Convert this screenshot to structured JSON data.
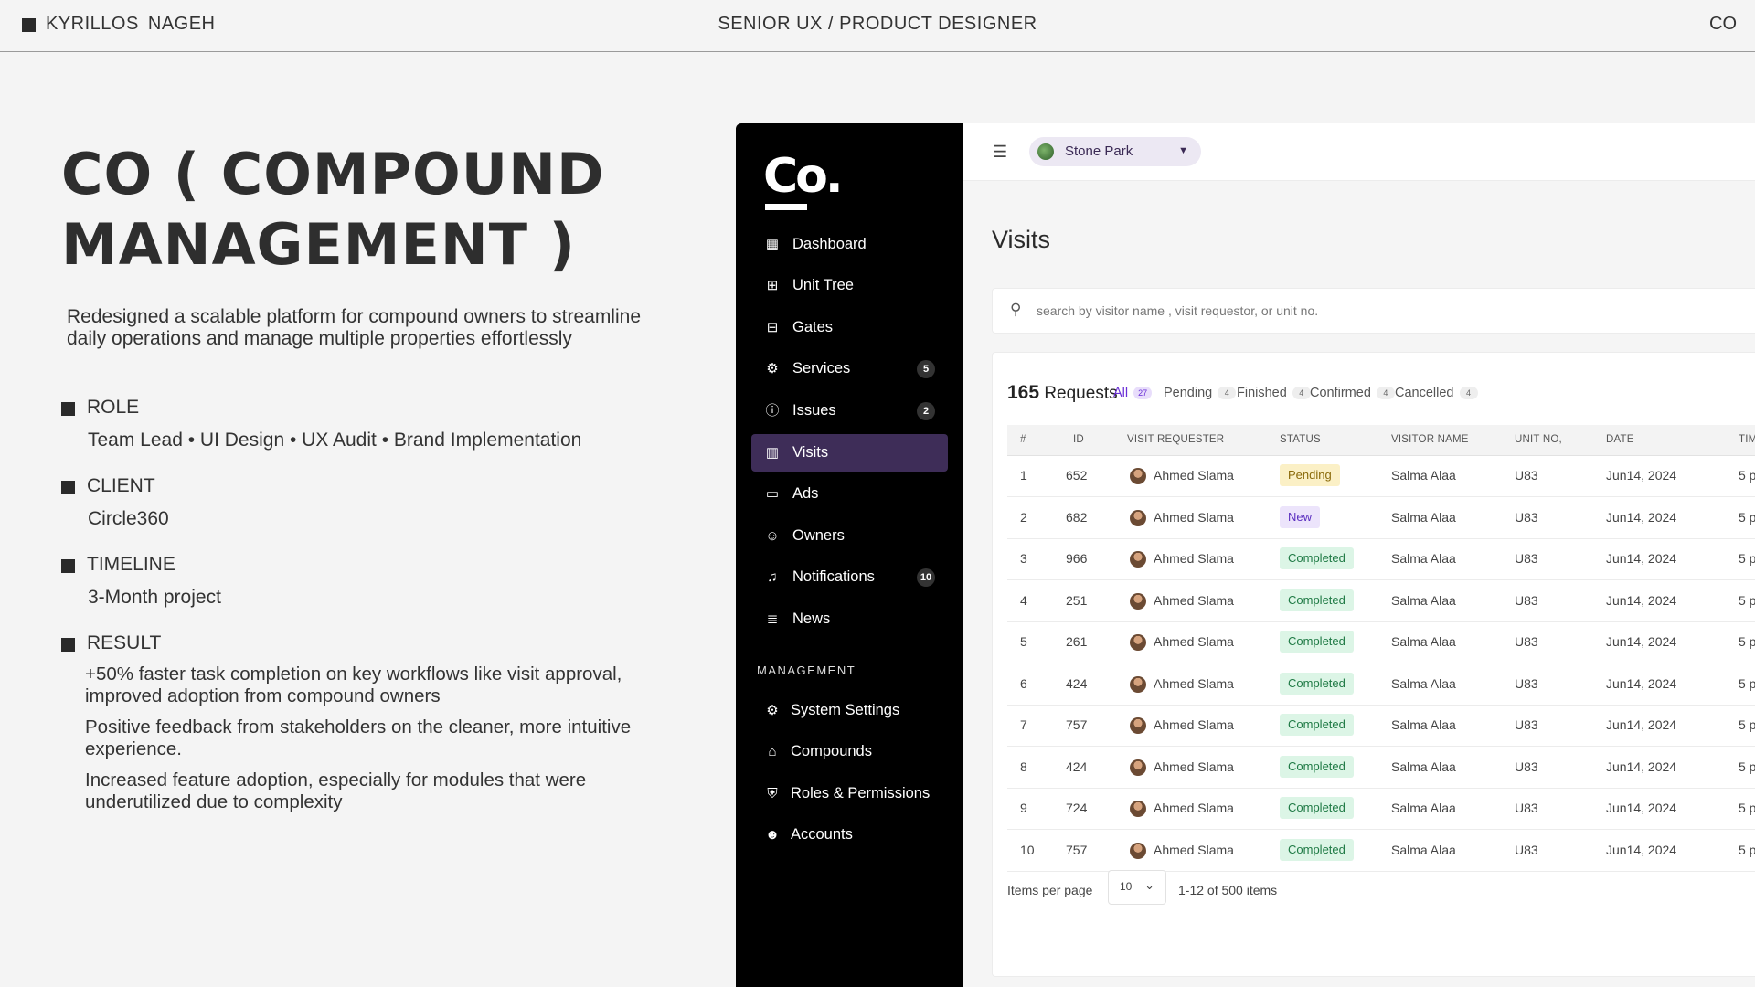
{
  "topbar": {
    "name": "KYRILLOS  NAGEH",
    "role": "SENIOR UX / PRODUCT DESIGNER",
    "short": "CO"
  },
  "case": {
    "title": "CO ( COMPOUND MANAGEMENT )",
    "description": "Redesigned a scalable platform for compound owners to streamline daily operations and manage multiple properties effortlessly",
    "sections": [
      {
        "label": "ROLE",
        "value": "Team Lead • UI Design • UX Audit • Brand Implementation"
      },
      {
        "label": "CLIENT",
        "value": "Circle360"
      },
      {
        "label": "TIMELINE",
        "value": "3-Month project"
      },
      {
        "label": "RESULT",
        "value": ""
      }
    ],
    "results": [
      "+50% faster task completion on key workflows like visit approval, improved adoption from compound owners",
      "Positive feedback from stakeholders on the cleaner, more intuitive experience.",
      "Increased feature adoption, especially for modules that were underutilized due to complexity"
    ]
  },
  "app": {
    "logo": "Co.",
    "nav": [
      {
        "label": "Dashboard",
        "icon": "dashboard-icon",
        "badge": ""
      },
      {
        "label": "Unit Tree",
        "icon": "tree-icon",
        "badge": ""
      },
      {
        "label": "Gates",
        "icon": "gate-icon",
        "badge": ""
      },
      {
        "label": "Services",
        "icon": "services-icon",
        "badge": "5"
      },
      {
        "label": "Issues",
        "icon": "alert-icon",
        "badge": "2"
      },
      {
        "label": "Visits",
        "icon": "building-icon",
        "badge": "",
        "active": true
      },
      {
        "label": "Ads",
        "icon": "ads-icon",
        "badge": ""
      },
      {
        "label": "Owners",
        "icon": "users-icon",
        "badge": ""
      },
      {
        "label": "Notifications",
        "icon": "bell-icon",
        "badge": "10"
      },
      {
        "label": "News",
        "icon": "news-icon",
        "badge": ""
      }
    ],
    "management_label": "MANAGEMENT",
    "management": [
      {
        "label": "System Settings",
        "icon": "gear-icon"
      },
      {
        "label": "Compounds",
        "icon": "compound-icon"
      },
      {
        "label": "Roles & Permissions",
        "icon": "shield-icon"
      },
      {
        "label": "Accounts",
        "icon": "account-icon"
      }
    ],
    "location": "Stone Park",
    "page_title": "Visits",
    "search_placeholder": "search by visitor name , visit requestor, or unit no.",
    "requests_count": "165",
    "requests_label": "Requests",
    "tabs": [
      {
        "label": "All",
        "count": "27",
        "active": true
      },
      {
        "label": "Pending",
        "count": "4"
      },
      {
        "label": "Finished",
        "count": "4"
      },
      {
        "label": "Confirmed",
        "count": "4"
      },
      {
        "label": "Cancelled",
        "count": "4"
      }
    ],
    "columns": [
      "#",
      "ID",
      "VISIT REQUESTER",
      "STATUS",
      "VISITOR NAME",
      "UNIT  NO,",
      "DATE",
      "TIM"
    ],
    "rows": [
      {
        "n": "1",
        "id": "652",
        "requester": "Ahmed Slama",
        "status": "Pending",
        "visitor": "Salma Alaa",
        "unit": "U83",
        "date": "Jun14, 2024",
        "time": "5 p"
      },
      {
        "n": "2",
        "id": "682",
        "requester": "Ahmed Slama",
        "status": "New",
        "visitor": "Salma Alaa",
        "unit": "U83",
        "date": "Jun14, 2024",
        "time": "5 p"
      },
      {
        "n": "3",
        "id": "966",
        "requester": "Ahmed Slama",
        "status": "Completed",
        "visitor": "Salma Alaa",
        "unit": "U83",
        "date": "Jun14, 2024",
        "time": "5 p"
      },
      {
        "n": "4",
        "id": "251",
        "requester": "Ahmed Slama",
        "status": "Completed",
        "visitor": "Salma Alaa",
        "unit": "U83",
        "date": "Jun14, 2024",
        "time": "5 p"
      },
      {
        "n": "5",
        "id": "261",
        "requester": "Ahmed Slama",
        "status": "Completed",
        "visitor": "Salma Alaa",
        "unit": "U83",
        "date": "Jun14, 2024",
        "time": "5 p"
      },
      {
        "n": "6",
        "id": "424",
        "requester": "Ahmed Slama",
        "status": "Completed",
        "visitor": "Salma Alaa",
        "unit": "U83",
        "date": "Jun14, 2024",
        "time": "5 p"
      },
      {
        "n": "7",
        "id": "757",
        "requester": "Ahmed Slama",
        "status": "Completed",
        "visitor": "Salma Alaa",
        "unit": "U83",
        "date": "Jun14, 2024",
        "time": "5 p"
      },
      {
        "n": "8",
        "id": "424",
        "requester": "Ahmed Slama",
        "status": "Completed",
        "visitor": "Salma Alaa",
        "unit": "U83",
        "date": "Jun14, 2024",
        "time": "5 p"
      },
      {
        "n": "9",
        "id": "724",
        "requester": "Ahmed Slama",
        "status": "Completed",
        "visitor": "Salma Alaa",
        "unit": "U83",
        "date": "Jun14, 2024",
        "time": "5 p"
      },
      {
        "n": "10",
        "id": "757",
        "requester": "Ahmed Slama",
        "status": "Completed",
        "visitor": "Salma Alaa",
        "unit": "U83",
        "date": "Jun14, 2024",
        "time": "5 p"
      }
    ],
    "items_per_page_label": "Items per page",
    "items_per_page": "10",
    "range_text": "1-12 of 500 items"
  },
  "colors": {
    "accent": "#6a2fd6",
    "sidebar": "#000000",
    "active_nav": "#3e2d58"
  }
}
